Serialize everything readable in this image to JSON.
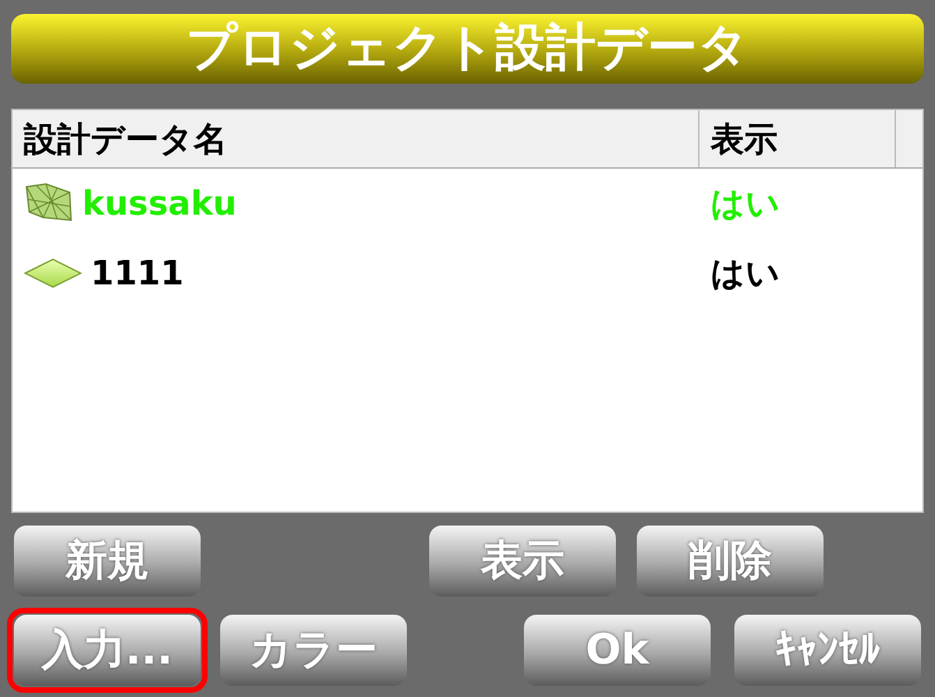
{
  "title": "プロジェクト設計データ",
  "table": {
    "columns": [
      "設計データ名",
      "表示"
    ],
    "rows": [
      {
        "kind": "mesh",
        "name": "kussaku",
        "display": "はい",
        "selected": true
      },
      {
        "kind": "plane",
        "name": "1111",
        "display": "はい",
        "selected": false
      }
    ]
  },
  "button_rows": [
    [
      {
        "label": "新規",
        "focused": false
      },
      {
        "label": "表示",
        "focused": false
      },
      {
        "label": "削除",
        "focused": false
      }
    ],
    [
      {
        "label": "入力...",
        "focused": true
      },
      {
        "label": "カラー",
        "focused": false
      },
      {
        "label": "Ok",
        "focused": false
      },
      {
        "label": "ｷｬﾝｾﾙ",
        "focused": false
      }
    ]
  ]
}
